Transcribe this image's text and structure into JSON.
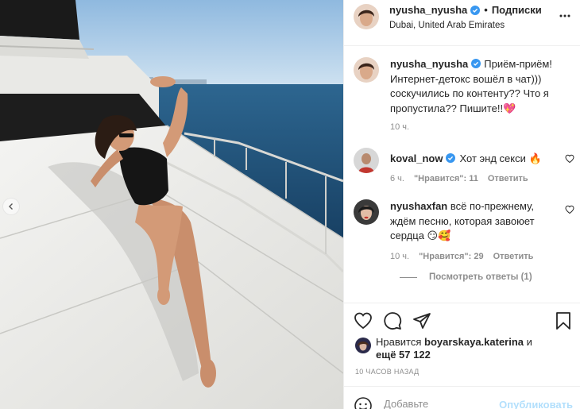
{
  "post": {
    "author": "nyusha_nyusha",
    "follow_label": "Подписки",
    "separator": "•",
    "location": "Dubai, United Arab Emirates"
  },
  "comments": [
    {
      "user": "nyusha_nyusha",
      "verified": true,
      "text": "Приём-приём! Интернет-детокс вошёл в чат))) соскучились по контенту?? Что я пропустила?? Пишите!!💖",
      "time": "10 ч."
    },
    {
      "user": "koval_now",
      "verified": true,
      "text": "Хот энд секси 🔥",
      "time": "6 ч.",
      "likes": "\"Нравится\": 11",
      "reply": "Ответить"
    },
    {
      "user": "nyushaxfan",
      "verified": false,
      "text": "всё по-прежнему, ждём песню, которая завоюет сердца 😏🥰",
      "time": "10 ч.",
      "likes": "\"Нравится\": 29",
      "reply": "Ответить"
    }
  ],
  "view_replies": "Посмотреть ответы (1)",
  "likes_block": {
    "prefix": "Нравится",
    "user": "boyarskaya.katerina",
    "middle": "и",
    "others": "ещё 57 122"
  },
  "timestamp": "10 ЧАСОВ НАЗАД",
  "add_comment": {
    "placeholder": "Добавьте",
    "publish_label": "Опубликовать"
  },
  "icons": {
    "verified": "verified-badge-icon",
    "more": "more-options-icon",
    "like": "heart-icon",
    "comment": "comment-icon",
    "share": "paper-plane-icon",
    "save": "bookmark-icon",
    "emoji": "smiley-icon",
    "carousel": "chevron-left-icon"
  },
  "colors": {
    "verified_blue": "#3897f0",
    "muted_text": "#8e8e8e",
    "publish_disabled": "#b2dffc",
    "sea": "#1f4f78",
    "sky": "#a9cbe6"
  }
}
